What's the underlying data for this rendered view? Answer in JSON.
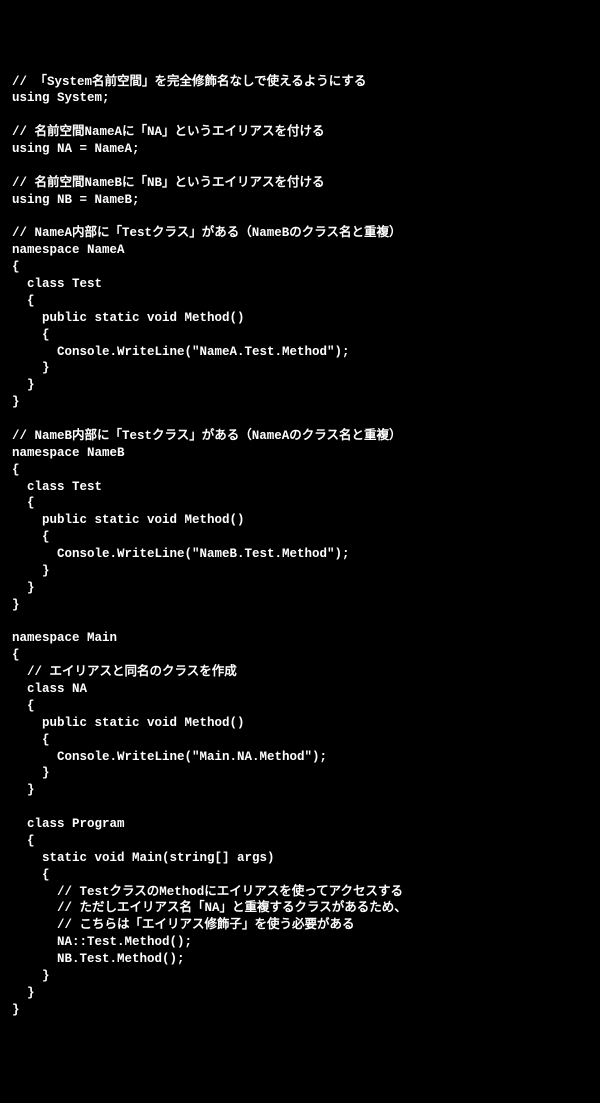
{
  "code": {
    "lines": [
      "// 「System名前空間」を完全修飾名なしで使えるようにする",
      "using System;",
      "",
      "// 名前空間NameAに「NA」というエイリアスを付ける",
      "using NA = NameA;",
      "",
      "// 名前空間NameBに「NB」というエイリアスを付ける",
      "using NB = NameB;",
      "",
      "// NameA内部に「Testクラス」がある（NameBのクラス名と重複）",
      "namespace NameA",
      "{",
      "  class Test",
      "  {",
      "    public static void Method()",
      "    {",
      "      Console.WriteLine(\"NameA.Test.Method\");",
      "    }",
      "  }",
      "}",
      "",
      "// NameB内部に「Testクラス」がある（NameAのクラス名と重複）",
      "namespace NameB",
      "{",
      "  class Test",
      "  {",
      "    public static void Method()",
      "    {",
      "      Console.WriteLine(\"NameB.Test.Method\");",
      "    }",
      "  }",
      "}",
      "",
      "namespace Main",
      "{",
      "  // エイリアスと同名のクラスを作成",
      "  class NA",
      "  {",
      "    public static void Method()",
      "    {",
      "      Console.WriteLine(\"Main.NA.Method\");",
      "    }",
      "  }",
      "",
      "  class Program",
      "  {",
      "    static void Main(string[] args)",
      "    {",
      "      // TestクラスのMethodにエイリアスを使ってアクセスする",
      "      // ただしエイリアス名「NA」と重複するクラスがあるため、",
      "      // こちらは「エイリアス修飾子」を使う必要がある",
      "      NA::Test.Method();",
      "      NB.Test.Method();",
      "    }",
      "  }",
      "}"
    ]
  }
}
